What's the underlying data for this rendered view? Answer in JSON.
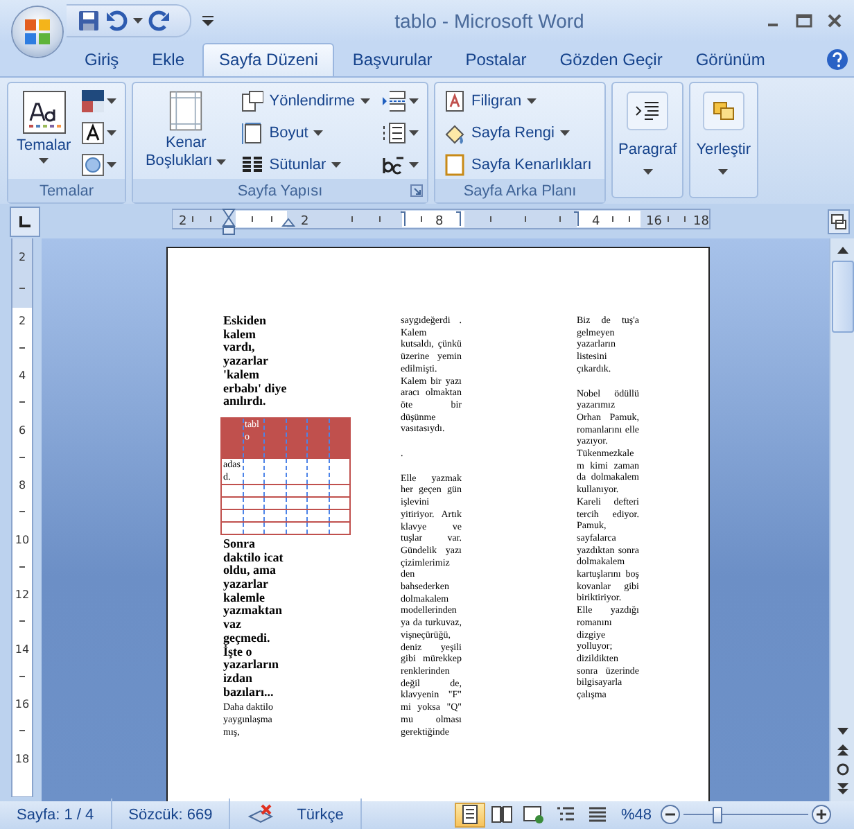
{
  "window": {
    "title": "tablo - Microsoft Word"
  },
  "tabs": [
    {
      "label": "Giriş",
      "selected": false
    },
    {
      "label": "Ekle",
      "selected": false
    },
    {
      "label": "Sayfa Düzeni",
      "selected": true
    },
    {
      "label": "Başvurular",
      "selected": false
    },
    {
      "label": "Postalar",
      "selected": false
    },
    {
      "label": "Gözden Geçir",
      "selected": false
    },
    {
      "label": "Görünüm",
      "selected": false
    }
  ],
  "ribbon": [
    {
      "kind": "themes",
      "title": "Temalar",
      "large": "Temalar"
    },
    {
      "kind": "page_setup",
      "title": "Sayfa Yapısı",
      "large": "Kenar Boşlukları",
      "commands": [
        {
          "label": "Yönlendirme",
          "dropdown": true
        },
        {
          "label": "Boyut",
          "dropdown": true
        },
        {
          "label": "Sütunlar",
          "dropdown": true
        }
      ]
    },
    {
      "kind": "background",
      "title": "Sayfa Arka Planı",
      "commands": [
        {
          "label": "Filigran",
          "dropdown": true
        },
        {
          "label": "Sayfa Rengi",
          "dropdown": true
        },
        {
          "label": "Sayfa Kenarlıkları",
          "dropdown": false
        }
      ]
    },
    {
      "kind": "collapsed",
      "title": "Paragraf"
    },
    {
      "kind": "collapsed",
      "title": "Yerleştir"
    }
  ],
  "ruler": {
    "labels": [
      "2",
      "2",
      "8",
      "4",
      "16",
      "18"
    ],
    "vertical_labels": [
      "2",
      "2",
      "4",
      "6",
      "8",
      "10",
      "12",
      "14",
      "16",
      "18"
    ]
  },
  "document": {
    "columns": [
      {
        "blocks": [
          {
            "kind": "paragraph",
            "bold": true,
            "justified": false,
            "text": "Eskiden kalem vardı, yazarlar 'kalem erbabı' diye anılırdı."
          },
          {
            "kind": "table",
            "rows": [
              {
                "header": true,
                "cells": [
                  null,
                  "tablo",
                  null,
                  null,
                  null,
                  null
                ]
              },
              {
                "header": false,
                "cells": [
                  "adasd.",
                  null,
                  null,
                  null,
                  null,
                  null
                ]
              },
              {
                "header": false,
                "cells": [
                  null,
                  null,
                  null,
                  null,
                  null,
                  null
                ]
              },
              {
                "header": false,
                "cells": [
                  null,
                  null,
                  null,
                  null,
                  null,
                  null
                ]
              },
              {
                "header": false,
                "cells": [
                  null,
                  null,
                  null,
                  null,
                  null,
                  null
                ]
              },
              {
                "header": false,
                "cells": [
                  null,
                  null,
                  null,
                  null,
                  null,
                  null
                ]
              }
            ]
          },
          {
            "kind": "paragraph",
            "bold": true,
            "justified": false,
            "text": "Sonra daktilo icat oldu, ama yazarlar kalemle yazmaktan vaz geçmedi. İşte o yazarların izdan bazıları..."
          },
          {
            "kind": "paragraph",
            "bold": false,
            "justified": false,
            "text": "Daha daktilo yaygınlaşma mış,"
          }
        ]
      },
      {
        "blocks": [
          {
            "kind": "paragraph",
            "bold": false,
            "justified": true,
            "text": "saygıdeğerdi . Kalem kutsaldı, çünkü üzerine yemin edilmişti. Kalem bir yazı aracı olmaktan öte bir düşünme vasıtasıydı."
          },
          {
            "kind": "paragraph",
            "bold": false,
            "text": "."
          },
          {
            "kind": "paragraph",
            "bold": false,
            "justified": true,
            "text": "Elle yazmak her geçen gün işlevini yitiriyor. Artık klavye ve tuşlar var. Gündelik yazı çizimlerimiz den bahsederken dolmakalem modellerinden ya da turkuvaz, vişneçürüğü, deniz yeşili gibi mürekkep renklerinden değil de, klavyenin \"F\" mi yoksa \"Q\" mu olması gerektiğinde"
          }
        ]
      },
      {
        "blocks": [
          {
            "kind": "paragraph",
            "bold": false,
            "justified": true,
            "text": "Biz de tuş'a gelmeyen yazarların listesini çıkardık."
          },
          {
            "kind": "paragraph",
            "bold": false,
            "justified": true,
            "text": "Nobel ödüllü yazarımız Orhan Pamuk, romanlarını elle yazıyor. Tükenmezkalem kimi zaman da dolmakalem kullanıyor. Kareli defteri tercih ediyor. Pamuk, sayfalarca yazdıktan sonra dolmakalem kartuşlarını boş kovanlar gibi biriktiriyor. Elle yazdığı romanını dizgiye yolluyor; dizildikten sonra üzerinde bilgisayarla çalışma"
          }
        ]
      }
    ]
  },
  "status_bar": {
    "page": "Sayfa: 1 / 4",
    "words": "Sözcük: 669",
    "language": "Türkçe",
    "views": [
      {
        "selected": true
      },
      {
        "selected": false
      },
      {
        "selected": false
      },
      {
        "selected": false
      },
      {
        "selected": false
      }
    ],
    "zoom": "%48",
    "zoom_slider": {
      "level": 0.27
    }
  }
}
